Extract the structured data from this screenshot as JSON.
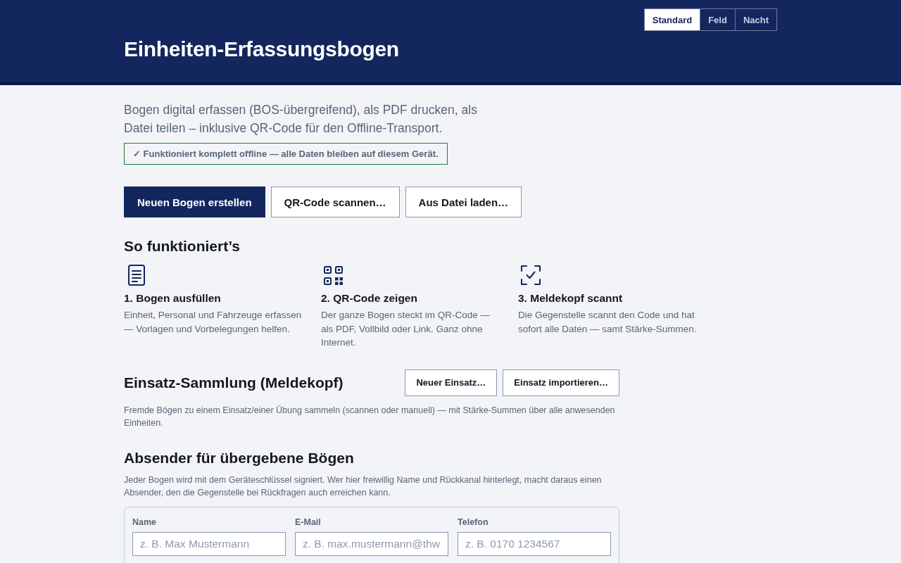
{
  "header": {
    "title": "Einheiten-Erfassungsbogen",
    "theme_switch": [
      {
        "label": "Standard",
        "selected": true
      },
      {
        "label": "Feld",
        "selected": false
      },
      {
        "label": "Nacht",
        "selected": false
      }
    ]
  },
  "intro": {
    "text": "Bogen digital erfassen (BOS-übergreifend), als PDF drucken, als Datei teilen – inklusive QR-Code für den Offline-Transport.",
    "offline_notice": "✓ Funktioniert komplett offline — alle Daten bleiben auf diesem Gerät."
  },
  "actions": [
    {
      "label": "Neuen Bogen erstellen",
      "kind": "primary"
    },
    {
      "label": "QR-Code scannen…",
      "kind": "secondary"
    },
    {
      "label": "Aus Datei laden…",
      "kind": "secondary"
    }
  ],
  "how_it_works": {
    "title": "So funktioniert’s",
    "steps": [
      {
        "title": "1. Bogen ausfüllen",
        "text": "Einheit, Personal und Fahrzeuge erfassen — Vorlagen und Vorbelegungen helfen."
      },
      {
        "title": "2. QR-Code zeigen",
        "text": "Der ganze Bogen steckt im QR-Code — als PDF, Vollbild oder Link. Ganz ohne Internet."
      },
      {
        "title": "3. Meldekopf scannt",
        "text": "Die Gegenstelle scannt den Code und hat sofort alle Daten — samt Stärke-Summen."
      }
    ]
  },
  "collection": {
    "title": "Einsatz-Sammlung (Meldekopf)",
    "buttons": [
      "Neuer Einsatz…",
      "Einsatz importieren…"
    ],
    "description": "Fremde Bögen zu einem Einsatz/einer Übung sammeln (scannen oder manuell) — mit Stärke-Summen über alle anwesenden Einheiten."
  },
  "sender": {
    "title": "Absender für übergebene Bögen",
    "description": "Jeder Bogen wird mit dem Geräteschlüssel signiert. Wer hier freiwillig Name und Rückkanal hinterlegt, macht daraus einen Absender, den die Gegenstelle bei Rückfragen auch erreichen kann.",
    "fields": [
      {
        "label": "Name",
        "placeholder": "z. B. Max Mustermann"
      },
      {
        "label": "E-Mail",
        "placeholder": "z. B. max.mustermann@thw"
      },
      {
        "label": "Telefon",
        "placeholder": "z. B. 0170 1234567"
      }
    ]
  }
}
